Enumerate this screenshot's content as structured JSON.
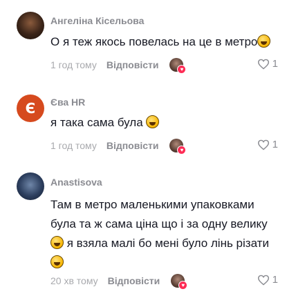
{
  "comments": [
    {
      "username": "Ангеліна Кісельова",
      "text": "О я теж якось повелась на це в метро",
      "emoji": "grinning-sweat-emoji",
      "time": "1 год тому",
      "reply_label": "Відповісти",
      "likes": "1"
    },
    {
      "username": "Єва HR",
      "avatar_letter": "Є",
      "text": "я така сама була",
      "emoji": "laughing-emoji",
      "time": "1 год тому",
      "reply_label": "Відповісти",
      "likes": "1"
    },
    {
      "username": "Anastisova",
      "text_line1": "Там в метро маленькими упаковками",
      "text_line2": "була та ж сама ціна що і за одну велику",
      "text_line3": "я взяла малі бо мені було лінь різати",
      "emoji": "grinning-emoji",
      "emoji_end": "rolling-laughing-emoji",
      "time": "20 хв тому",
      "reply_label": "Відповісти",
      "likes": "1"
    }
  ],
  "colors": {
    "heart_badge": "#fe2c55",
    "avatar_letter_bg": "#d64a1e",
    "muted_text": "#8a8b91"
  }
}
